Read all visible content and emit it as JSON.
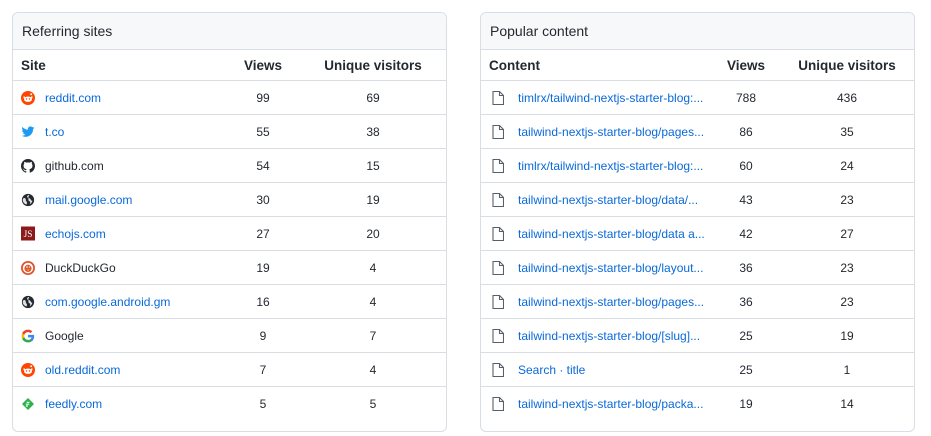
{
  "referring": {
    "title": "Referring sites",
    "columns": {
      "site": "Site",
      "views": "Views",
      "unique": "Unique visitors"
    },
    "rows": [
      {
        "name": "reddit.com",
        "views": "99",
        "unique": "69",
        "icon": "reddit-icon",
        "link": true
      },
      {
        "name": "t.co",
        "views": "55",
        "unique": "38",
        "icon": "twitter-icon",
        "link": true
      },
      {
        "name": "github.com",
        "views": "54",
        "unique": "15",
        "icon": "github-icon",
        "link": false
      },
      {
        "name": "mail.google.com",
        "views": "30",
        "unique": "19",
        "icon": "globe-icon",
        "link": true
      },
      {
        "name": "echojs.com",
        "views": "27",
        "unique": "20",
        "icon": "echojs-icon",
        "link": true
      },
      {
        "name": "DuckDuckGo",
        "views": "19",
        "unique": "4",
        "icon": "duckduckgo-icon",
        "link": false
      },
      {
        "name": "com.google.android.gm",
        "views": "16",
        "unique": "4",
        "icon": "globe-icon",
        "link": true
      },
      {
        "name": "Google",
        "views": "9",
        "unique": "7",
        "icon": "google-icon",
        "link": false
      },
      {
        "name": "old.reddit.com",
        "views": "7",
        "unique": "4",
        "icon": "reddit-icon",
        "link": true
      },
      {
        "name": "feedly.com",
        "views": "5",
        "unique": "5",
        "icon": "feedly-icon",
        "link": true
      }
    ]
  },
  "popular": {
    "title": "Popular content",
    "columns": {
      "content": "Content",
      "views": "Views",
      "unique": "Unique visitors"
    },
    "rows": [
      {
        "name": "timlrx/tailwind-nextjs-starter-blog:...",
        "views": "788",
        "unique": "436"
      },
      {
        "name": "tailwind-nextjs-starter-blog/pages...",
        "views": "86",
        "unique": "35"
      },
      {
        "name": "timlrx/tailwind-nextjs-starter-blog:...",
        "views": "60",
        "unique": "24"
      },
      {
        "name": "tailwind-nextjs-starter-blog/data/...",
        "views": "43",
        "unique": "23"
      },
      {
        "name": "tailwind-nextjs-starter-blog/data a...",
        "views": "42",
        "unique": "27"
      },
      {
        "name": "tailwind-nextjs-starter-blog/layout...",
        "views": "36",
        "unique": "23"
      },
      {
        "name": "tailwind-nextjs-starter-blog/pages...",
        "views": "36",
        "unique": "23"
      },
      {
        "name": "tailwind-nextjs-starter-blog/[slug]...",
        "views": "25",
        "unique": "19"
      },
      {
        "name": "Search · title",
        "views": "25",
        "unique": "1"
      },
      {
        "name": "tailwind-nextjs-starter-blog/packa...",
        "views": "19",
        "unique": "14"
      }
    ]
  },
  "colors": {
    "link": "#0969da",
    "border": "#d8dee4",
    "header_bg": "#f6f8fa",
    "text": "#24292f"
  }
}
